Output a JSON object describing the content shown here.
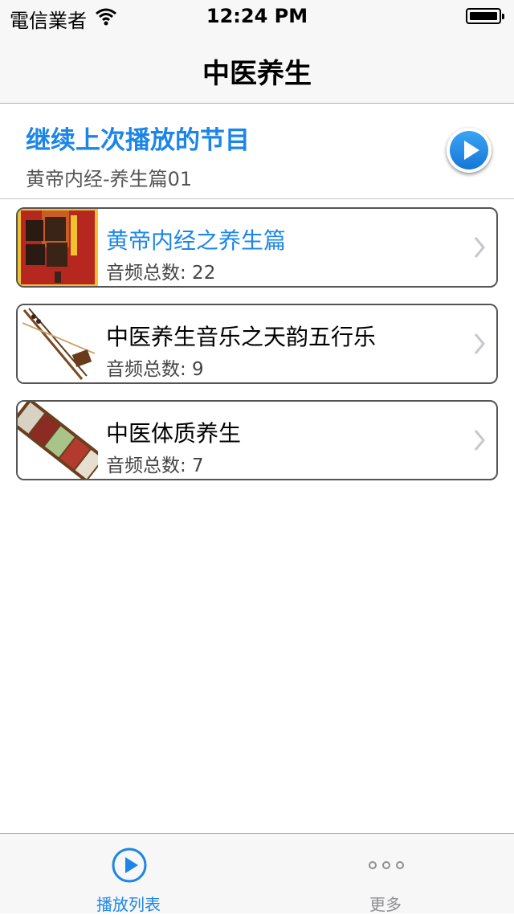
{
  "status_bar": {
    "carrier": "電信業者",
    "time": "12:24 PM"
  },
  "nav": {
    "title": "中医养生"
  },
  "resume": {
    "heading": "继续上次播放的节目",
    "subtitle": "黄帝内经-养生篇01"
  },
  "programs": [
    {
      "title": "黄帝内经之养生篇",
      "count": "音频总数: 22",
      "thumbnail": "book-cover-image",
      "highlighted": true
    },
    {
      "title": "中医养生音乐之天韵五行乐",
      "count": "音频总数: 9",
      "thumbnail": "erhu-instrument-image",
      "highlighted": false
    },
    {
      "title": "中医体质养生",
      "count": "音频总数: 7",
      "thumbnail": "grains-tray-image",
      "highlighted": false
    }
  ],
  "tabbar": {
    "tabs": [
      {
        "label": "播放列表",
        "icon": "play-circle-icon",
        "active": true
      },
      {
        "label": "更多",
        "icon": "more-dots-icon",
        "active": false
      }
    ]
  },
  "colors": {
    "accent": "#1b86e8",
    "bar_background": "#f7f7f7",
    "card_border": "#555555"
  }
}
